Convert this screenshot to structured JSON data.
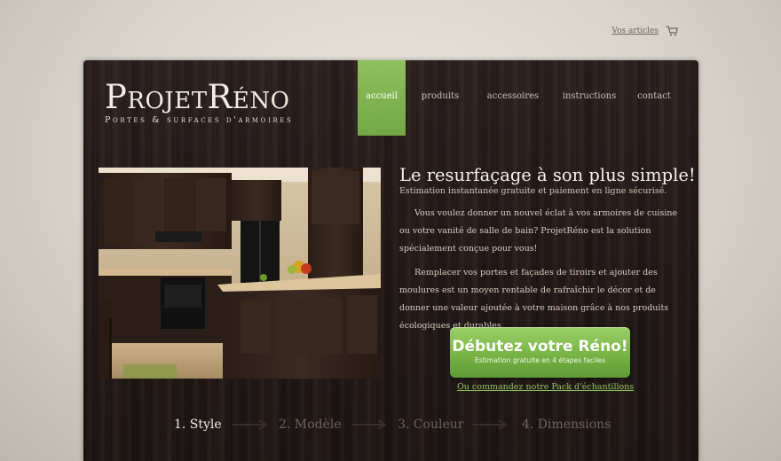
{
  "topbar": {
    "articles_link": "Vos articles",
    "cart_icon": "shopping-cart-icon"
  },
  "logo": {
    "title": "ProjetRéno",
    "subtitle": "Portes & surfaces d'armoires"
  },
  "nav": {
    "items": [
      {
        "label": "accueil",
        "active": true
      },
      {
        "label": "produits"
      },
      {
        "label": "accessoires"
      },
      {
        "label": "instructions"
      },
      {
        "label": "contact"
      }
    ]
  },
  "hero": {
    "headline": "Le resurfaçage à son plus simple!",
    "subheadline": "Estimation instantanée gratuite et paiement en ligne sécurisé.",
    "paragraph1": "Vous voulez donner un nouvel éclat à vos armoires de cuisine ou votre vanité de salle de bain? ProjetRéno est la solution spécialement conçue pour vous!",
    "paragraph2": "Remplacer vos portes et façades de tiroirs et ajouter des moulures est un moyen rentable de rafraîchir le décor et de donner une valeur ajoutée à votre maison grâce à nos produits écologiques et durables."
  },
  "cta": {
    "title": "Débutez votre Réno!",
    "subtitle": "Estimation gratuite en 4 étapes faciles"
  },
  "sample_link": "Ou commandez notre Pack d'échantillons",
  "steps": [
    {
      "label": "1. Style",
      "active": true
    },
    {
      "label": "2. Modèle"
    },
    {
      "label": "3. Couleur"
    },
    {
      "label": "4. Dimensions"
    }
  ],
  "colors": {
    "accent_green": "#7ab648",
    "wood_dark": "#241a18",
    "link_green": "#92c460"
  }
}
